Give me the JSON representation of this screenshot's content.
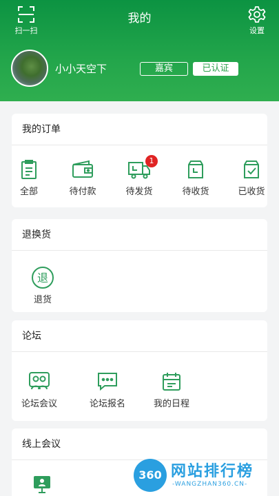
{
  "header": {
    "title": "我的",
    "scan_label": "扫一扫",
    "settings_label": "设置",
    "username": "小小天空下",
    "badge_guest": "嘉宾",
    "badge_verified": "已认证"
  },
  "orders": {
    "title": "我的订单",
    "items": [
      {
        "label": "全部",
        "icon": "clipboard-icon"
      },
      {
        "label": "待付款",
        "icon": "wallet-icon"
      },
      {
        "label": "待发货",
        "icon": "truck-icon",
        "badge": "1"
      },
      {
        "label": "待收货",
        "icon": "package-icon"
      },
      {
        "label": "已收货",
        "icon": "box-check-icon"
      }
    ]
  },
  "returns": {
    "title": "退换货",
    "items": [
      {
        "label": "退货",
        "icon": "return-icon",
        "glyph": "退"
      }
    ]
  },
  "forum": {
    "title": "论坛",
    "items": [
      {
        "label": "论坛会议",
        "icon": "group-icon"
      },
      {
        "label": "论坛报名",
        "icon": "chat-icon"
      },
      {
        "label": "我的日程",
        "icon": "calendar-icon"
      }
    ]
  },
  "online_meeting": {
    "title": "线上会议",
    "items": [
      {
        "icon": "presentation-icon"
      }
    ]
  },
  "watermark": {
    "logo": "360",
    "name": "网站排行榜",
    "url": "-WANGZHAN360.CN-"
  },
  "colors": {
    "brand_green": "#1e9c47",
    "icon_green": "#2e9d5c",
    "badge_red": "#e02424",
    "watermark_blue": "#2a9fe0"
  }
}
